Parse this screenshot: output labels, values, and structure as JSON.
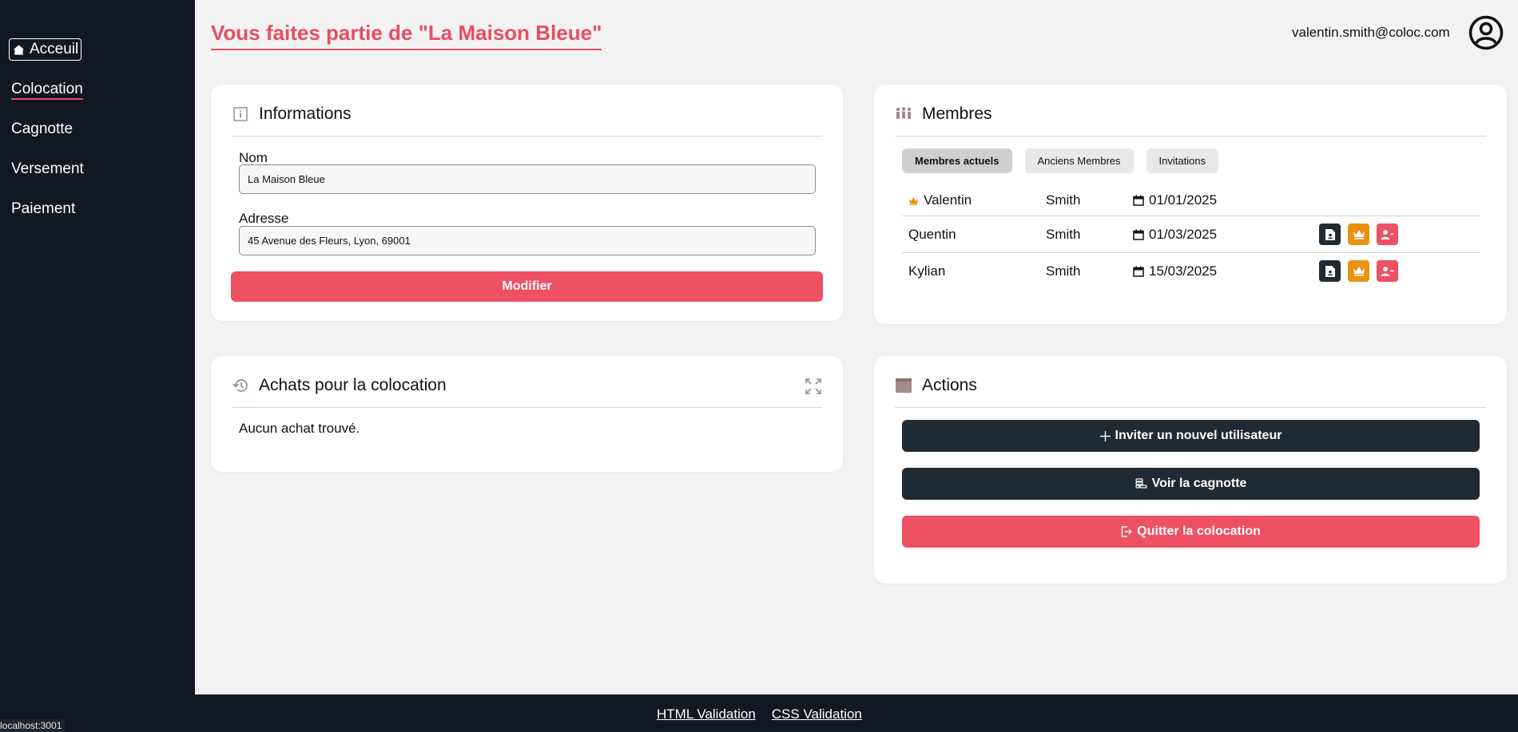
{
  "sidebar": {
    "home_label": "Acceuil",
    "items": [
      {
        "label": "Colocation",
        "active": true
      },
      {
        "label": "Cagnotte",
        "active": false
      },
      {
        "label": "Versement",
        "active": false
      },
      {
        "label": "Paiement",
        "active": false
      }
    ]
  },
  "header": {
    "title": "Vous faites partie de \"La Maison Bleue\"",
    "email": "valentin.smith@coloc.com",
    "avatar_icon": "user-circle-icon"
  },
  "informations": {
    "title": "Informations",
    "icon": "info-icon",
    "nom_label": "Nom",
    "nom_value": "La Maison Bleue",
    "adresse_label": "Adresse",
    "adresse_value": "45 Avenue des Fleurs, Lyon, 69001",
    "submit_label": "Modifier"
  },
  "membres": {
    "title": "Membres",
    "icon": "people-icon",
    "tabs": [
      {
        "label": "Membres actuels",
        "active": true
      },
      {
        "label": "Anciens Membres",
        "active": false
      },
      {
        "label": "Invitations",
        "active": false
      }
    ],
    "rows": [
      {
        "first": "Valentin",
        "last": "Smith",
        "date": "01/01/2025",
        "owner": true,
        "actions": false
      },
      {
        "first": "Quentin",
        "last": "Smith",
        "date": "01/03/2025",
        "owner": false,
        "actions": true
      },
      {
        "first": "Kylian",
        "last": "Smith",
        "date": "15/03/2025",
        "owner": false,
        "actions": true
      }
    ]
  },
  "achats": {
    "title": "Achats pour la colocation",
    "icon": "history-icon",
    "empty_text": "Aucun achat trouvé."
  },
  "actions": {
    "title": "Actions",
    "icon": "window-icon",
    "invite_label": "Inviter un nouvel utilisateur",
    "cagnotte_label": "Voir la cagnotte",
    "quit_label": "Quitter la colocation"
  },
  "footer": {
    "html_validation": "HTML Validation",
    "css_validation": "CSS Validation"
  },
  "status_bar": "localhost:3001",
  "colors": {
    "accent": "#e94d61",
    "sidebar_bg": "#121821",
    "dark_button": "#1f2a33",
    "crown_orange": "#e8920f"
  }
}
